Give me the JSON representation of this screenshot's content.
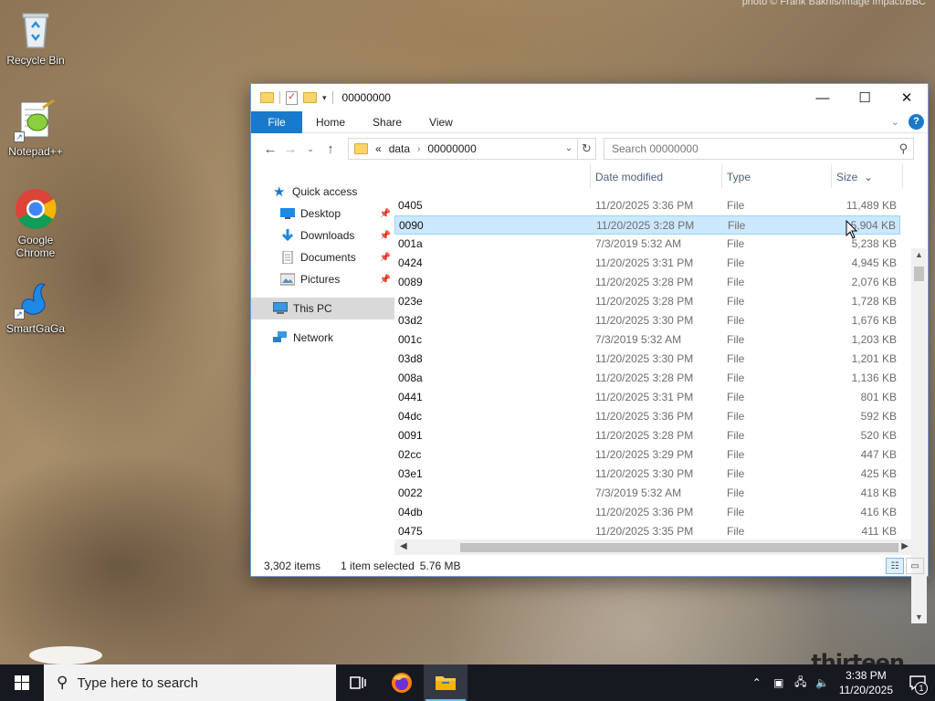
{
  "desktop": {
    "credit": "photo © Frank Bakhis/Image Impact/BBC",
    "watermark": "thirteen",
    "icons": [
      {
        "label": "Recycle Bin",
        "icon": "recycle-bin-icon"
      },
      {
        "label": "Notepad++",
        "icon": "notepad-plus-plus-icon"
      },
      {
        "label": "Google Chrome",
        "icon": "chrome-icon"
      },
      {
        "label": "SmartGaGa",
        "icon": "smartgaga-icon"
      }
    ]
  },
  "window": {
    "title": "00000000",
    "ribbon_tabs": [
      "File",
      "Home",
      "Share",
      "View"
    ],
    "address": {
      "overflow": "«",
      "crumbs": [
        "data",
        "00000000"
      ]
    },
    "search_placeholder": "Search 00000000",
    "nav": {
      "quick_access": "Quick access",
      "pinned": [
        "Desktop",
        "Downloads",
        "Documents",
        "Pictures"
      ],
      "this_pc": "This PC",
      "network": "Network"
    },
    "columns": {
      "date": "Date modified",
      "type": "Type",
      "size": "Size"
    },
    "files": [
      {
        "name": "0405",
        "date": "11/20/2025 3:36 PM",
        "type": "File",
        "size": "11,489 KB"
      },
      {
        "name": "0090",
        "date": "11/20/2025 3:28 PM",
        "type": "File",
        "size": "5,904 KB",
        "selected": true
      },
      {
        "name": "001a",
        "date": "7/3/2019 5:32 AM",
        "type": "File",
        "size": "5,238 KB"
      },
      {
        "name": "0424",
        "date": "11/20/2025 3:31 PM",
        "type": "File",
        "size": "4,945 KB"
      },
      {
        "name": "0089",
        "date": "11/20/2025 3:28 PM",
        "type": "File",
        "size": "2,076 KB"
      },
      {
        "name": "023e",
        "date": "11/20/2025 3:28 PM",
        "type": "File",
        "size": "1,728 KB"
      },
      {
        "name": "03d2",
        "date": "11/20/2025 3:30 PM",
        "type": "File",
        "size": "1,676 KB"
      },
      {
        "name": "001c",
        "date": "7/3/2019 5:32 AM",
        "type": "File",
        "size": "1,203 KB"
      },
      {
        "name": "03d8",
        "date": "11/20/2025 3:30 PM",
        "type": "File",
        "size": "1,201 KB"
      },
      {
        "name": "008a",
        "date": "11/20/2025 3:28 PM",
        "type": "File",
        "size": "1,136 KB"
      },
      {
        "name": "0441",
        "date": "11/20/2025 3:31 PM",
        "type": "File",
        "size": "801 KB"
      },
      {
        "name": "04dc",
        "date": "11/20/2025 3:36 PM",
        "type": "File",
        "size": "592 KB"
      },
      {
        "name": "0091",
        "date": "11/20/2025 3:28 PM",
        "type": "File",
        "size": "520 KB"
      },
      {
        "name": "02cc",
        "date": "11/20/2025 3:29 PM",
        "type": "File",
        "size": "447 KB"
      },
      {
        "name": "03e1",
        "date": "11/20/2025 3:30 PM",
        "type": "File",
        "size": "425 KB"
      },
      {
        "name": "0022",
        "date": "7/3/2019 5:32 AM",
        "type": "File",
        "size": "418 KB"
      },
      {
        "name": "04db",
        "date": "11/20/2025 3:36 PM",
        "type": "File",
        "size": "416 KB"
      },
      {
        "name": "0475",
        "date": "11/20/2025 3:35 PM",
        "type": "File",
        "size": "411 KB"
      }
    ],
    "status": {
      "items": "3,302 items",
      "selection": "1 item selected",
      "size": "5.76 MB"
    }
  },
  "taskbar": {
    "search_placeholder": "Type here to search",
    "time": "3:38 PM",
    "date": "11/20/2025",
    "notification_count": "1",
    "apps": [
      "task-view-icon",
      "firefox-icon",
      "file-explorer-icon"
    ],
    "accent": "#76b9ed"
  }
}
